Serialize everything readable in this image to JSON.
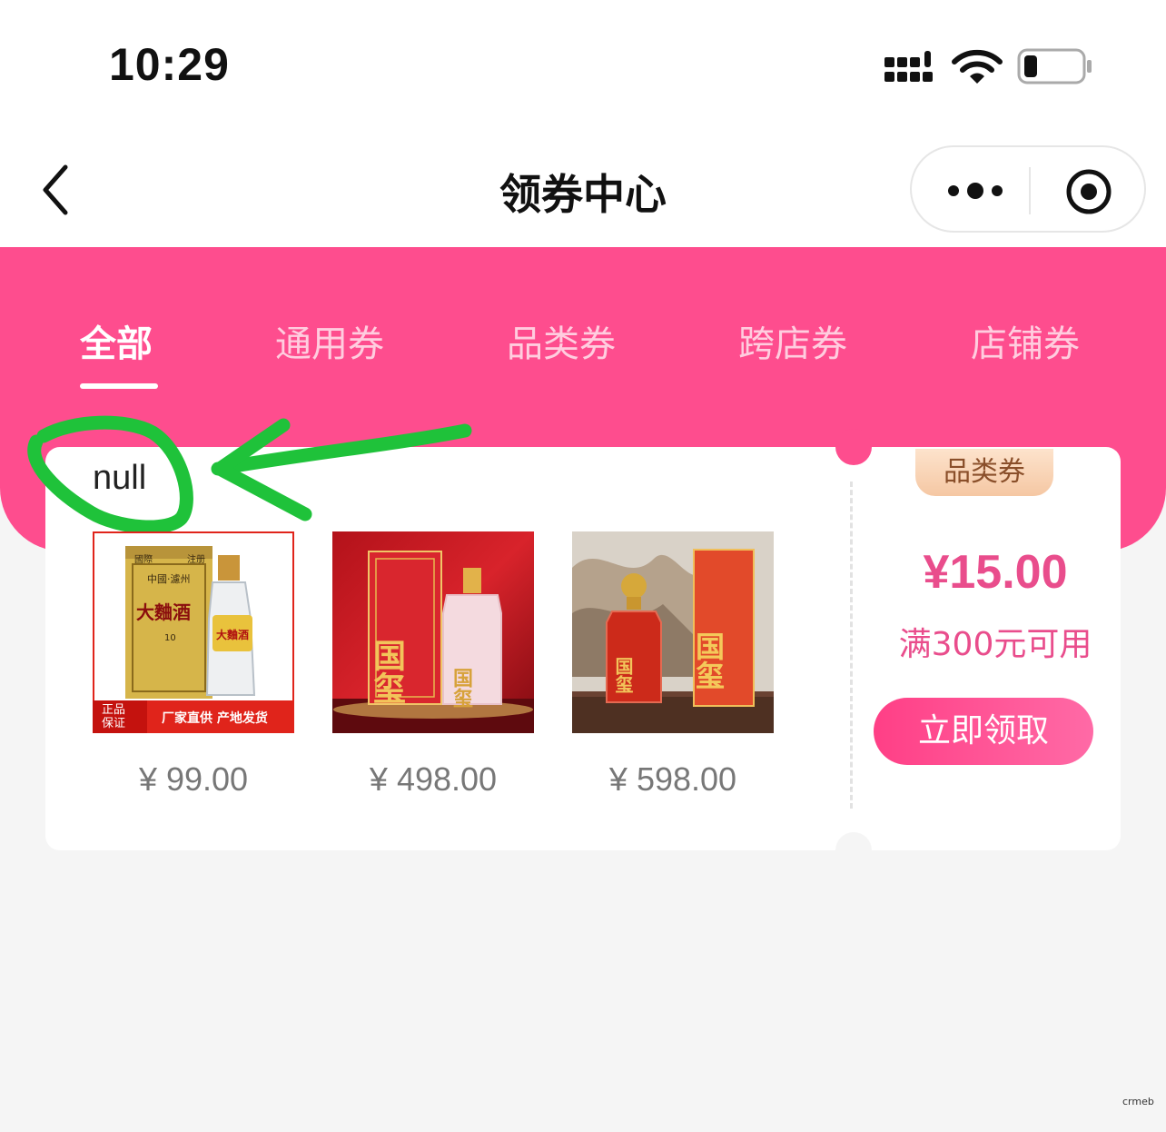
{
  "status": {
    "time": "10:29"
  },
  "nav": {
    "title": "领券中心"
  },
  "tabs": [
    {
      "label": "全部",
      "active": true
    },
    {
      "label": "通用券",
      "active": false
    },
    {
      "label": "品类券",
      "active": false
    },
    {
      "label": "跨店券",
      "active": false
    },
    {
      "label": "店铺券",
      "active": false
    }
  ],
  "coupon": {
    "store_name": "null",
    "products": [
      {
        "price": "¥ 99.00",
        "image": {
          "box_labels": [
            "國際",
            "注册",
            "中國·濾州",
            "大麯酒",
            "10"
          ],
          "bottle_label": "大麯酒",
          "strip": {
            "left": "正品\n保证",
            "right": "厂家直供 产地发货"
          }
        }
      },
      {
        "price": "¥ 498.00",
        "image": {
          "box_label": "国玺",
          "bottle_label": "国玺"
        }
      },
      {
        "price": "¥ 598.00",
        "image": {
          "box_label": "国玺",
          "bottle_label": "国玺"
        }
      }
    ],
    "type_badge": "品类券",
    "amount": "¥15.00",
    "condition": "满300元可用",
    "claim_label": "立即领取"
  },
  "watermark": "crmeb",
  "colors": {
    "accent": "#fe4d8e",
    "price_pink": "#e94d8c",
    "annotation_green": "#1fc23a"
  }
}
